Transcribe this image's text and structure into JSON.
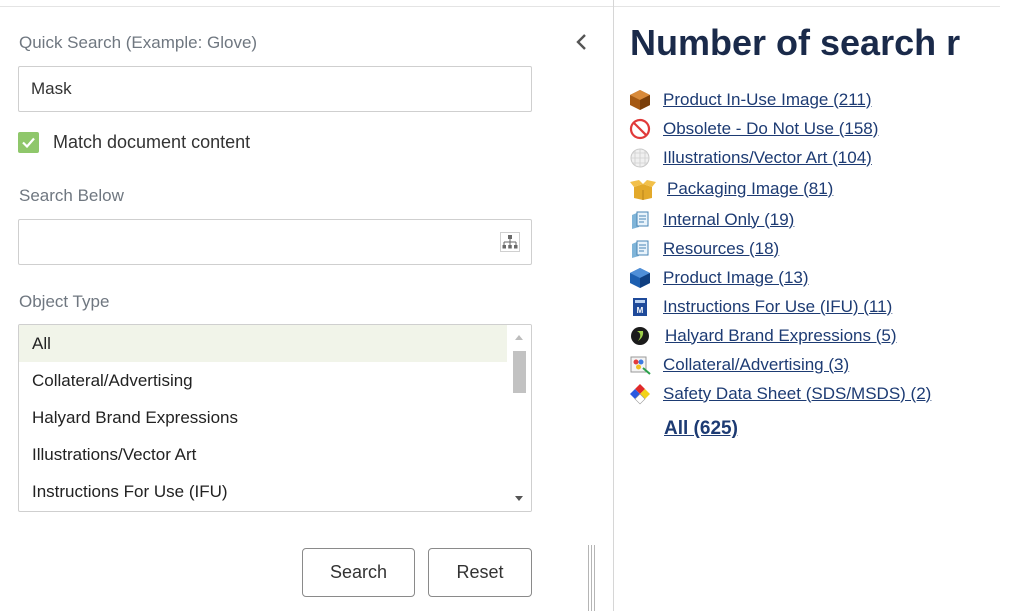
{
  "search": {
    "quick_label": "Quick Search (Example: Glove)",
    "quick_value": "Mask",
    "match_label": "Match document content",
    "match_checked": true,
    "below_label": "Search Below",
    "below_value": "",
    "type_label": "Object Type",
    "type_options": [
      "All",
      "Collateral/Advertising",
      "Halyard Brand Expressions",
      "Illustrations/Vector Art",
      "Instructions For Use (IFU)"
    ],
    "type_selected": "All",
    "search_btn": "Search",
    "reset_btn": "Reset"
  },
  "results": {
    "title": "Number of search r",
    "items": [
      {
        "label": "Product In-Use Image (211)",
        "icon": "brown-cube-icon"
      },
      {
        "label": "Obsolete - Do Not Use (158)",
        "icon": "prohibited-icon"
      },
      {
        "label": "Illustrations/Vector Art (104)",
        "icon": "wireframe-sphere-icon"
      },
      {
        "label": "Packaging Image (81)",
        "icon": "open-box-icon"
      },
      {
        "label": "Internal Only (19)",
        "icon": "document-stack-icon"
      },
      {
        "label": "Resources (18)",
        "icon": "document-stack-icon"
      },
      {
        "label": "Product Image (13)",
        "icon": "blue-cube-icon"
      },
      {
        "label": "Instructions For Use (IFU) (11)",
        "icon": "manual-book-icon"
      },
      {
        "label": "Halyard Brand Expressions (5)",
        "icon": "brand-logo-icon"
      },
      {
        "label": "Collateral/Advertising (3)",
        "icon": "palette-icon"
      },
      {
        "label": "Safety Data Sheet (SDS/MSDS) (2)",
        "icon": "hazard-diamond-icon"
      }
    ],
    "all_label": "All (625)"
  },
  "colors": {
    "title": "#1a2a4a",
    "link": "#1d3b73",
    "checkbox": "#8fc76b",
    "label_gray": "#6f7780"
  }
}
